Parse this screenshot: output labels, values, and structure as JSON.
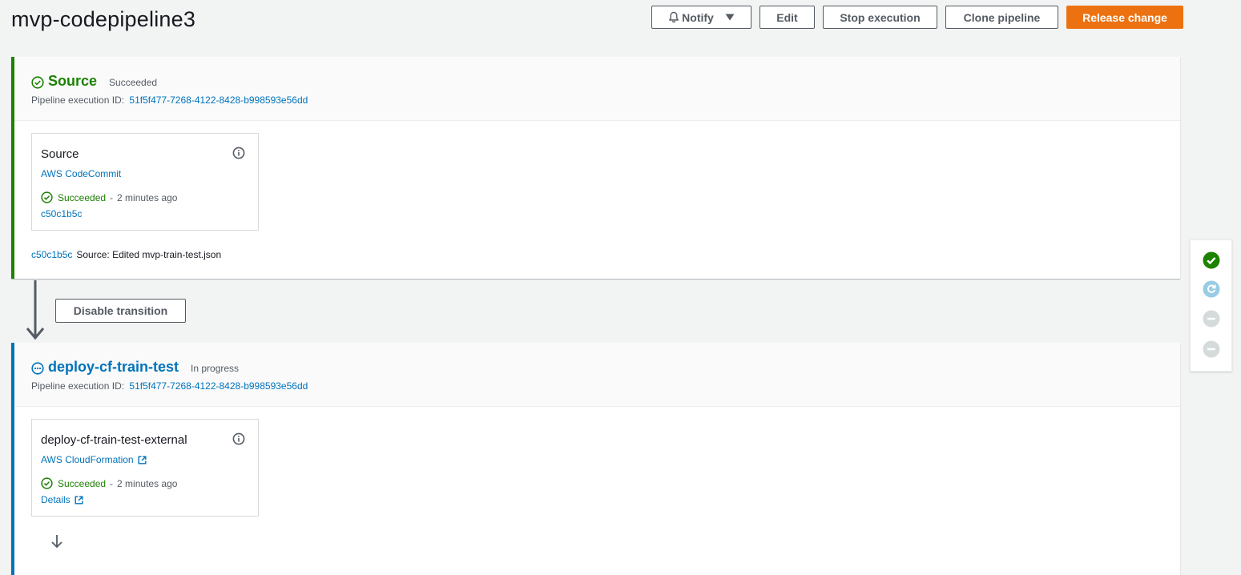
{
  "page": {
    "title": "mvp-codepipeline3"
  },
  "toolbar": {
    "notify_label": "Notify",
    "edit_label": "Edit",
    "stop_label": "Stop execution",
    "clone_label": "Clone pipeline",
    "release_label": "Release change"
  },
  "stages": [
    {
      "name": "Source",
      "status": "Succeeded",
      "exec_label": "Pipeline execution ID:",
      "exec_id": "51f5f477-7268-4122-8428-b998593e56dd",
      "action": {
        "name": "Source",
        "provider": "AWS CodeCommit",
        "status": "Succeeded",
        "sep": "-",
        "time": "2 minutes ago",
        "extra": "c50c1b5c"
      },
      "commit": {
        "id": "c50c1b5c",
        "message": "Source: Edited mvp-train-test.json"
      }
    },
    {
      "name": "deploy-cf-train-test",
      "status": "In progress",
      "exec_label": "Pipeline execution ID:",
      "exec_id": "51f5f477-7268-4122-8428-b998593e56dd",
      "action": {
        "name": "deploy-cf-train-test-external",
        "provider": "AWS CloudFormation",
        "status": "Succeeded",
        "sep": "-",
        "time": "2 minutes ago",
        "extra": "Details"
      }
    }
  ],
  "transition": {
    "button_label": "Disable transition"
  },
  "colors": {
    "success": "#1d8102",
    "progress": "#0073bb",
    "primary": "#ec7211",
    "link": "#0073bb"
  },
  "rail": [
    "succeeded",
    "in-progress",
    "not-started",
    "not-started"
  ]
}
